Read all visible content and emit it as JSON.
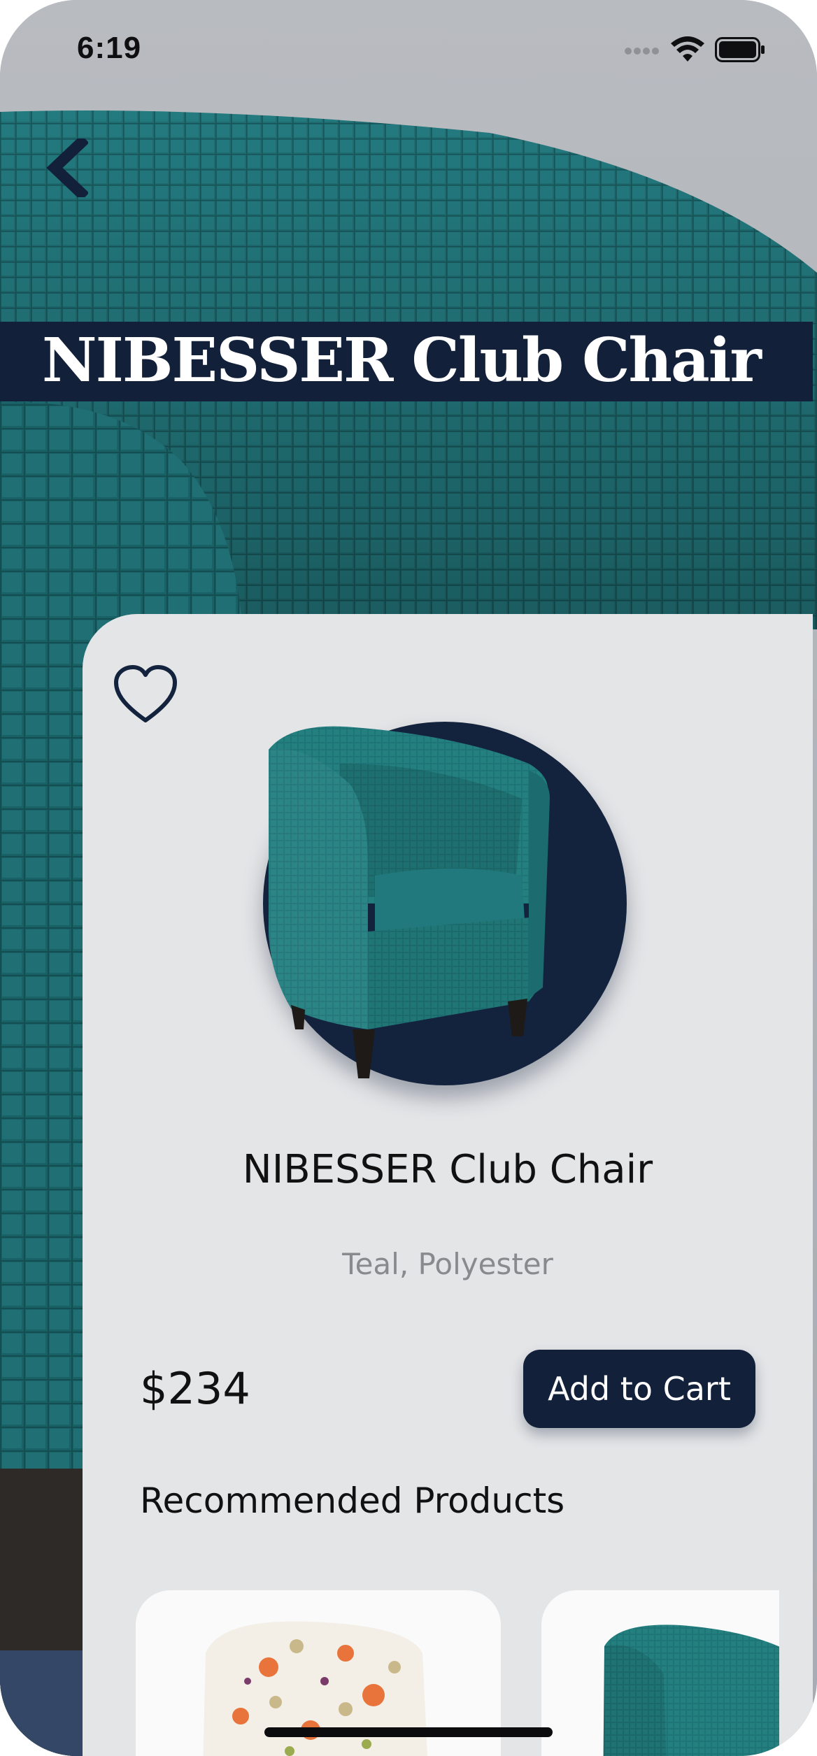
{
  "status_bar": {
    "time": "6:19",
    "icons": [
      "cellular-signal-icon",
      "wifi-icon",
      "battery-icon"
    ]
  },
  "navigation": {
    "back_icon": "chevron-left-icon"
  },
  "hero": {
    "title": "NIBESSER Club Chair"
  },
  "product": {
    "favorite_icon": "heart-outline-icon",
    "name": "NIBESSER Club Chair",
    "variant": "Teal, Polyester",
    "price": "$234",
    "add_to_cart_label": "Add to Cart"
  },
  "recommended": {
    "heading": "Recommended Products",
    "items": [
      {
        "image": "floral-tub-chair-image"
      },
      {
        "image": "teal-tub-chair-image"
      }
    ]
  },
  "colors": {
    "navy": "#12203a",
    "teal": "#1e6f73",
    "card_background": "#e4e5e7",
    "muted_text": "#8a8a8e"
  }
}
